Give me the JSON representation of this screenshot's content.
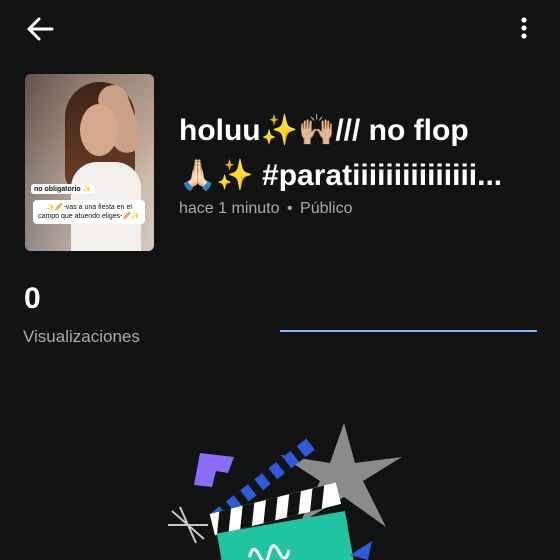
{
  "header": {
    "back_icon": "arrow-back-icon",
    "more_icon": "more-vert-icon"
  },
  "video": {
    "thumbnail": {
      "caption_small": "no obligatorio ✨",
      "caption_main": "✨🥖-vas a una fiesta en el campo que atuendo eliges-🥖✨"
    },
    "title_line1": "holuu✨🙌🏼/// no flop",
    "title_line2": "🙏🏻✨ #paratiiiiiiiiiiiiiii...",
    "time": "hace 1 minuto",
    "separator": "•",
    "visibility": "Público"
  },
  "stats": {
    "views": "0",
    "views_label": "Visualizaciones",
    "progress": 1.0
  },
  "colors": {
    "background": "#111212",
    "accent": "#8ab4f8",
    "secondary_text": "#a9aaab"
  }
}
